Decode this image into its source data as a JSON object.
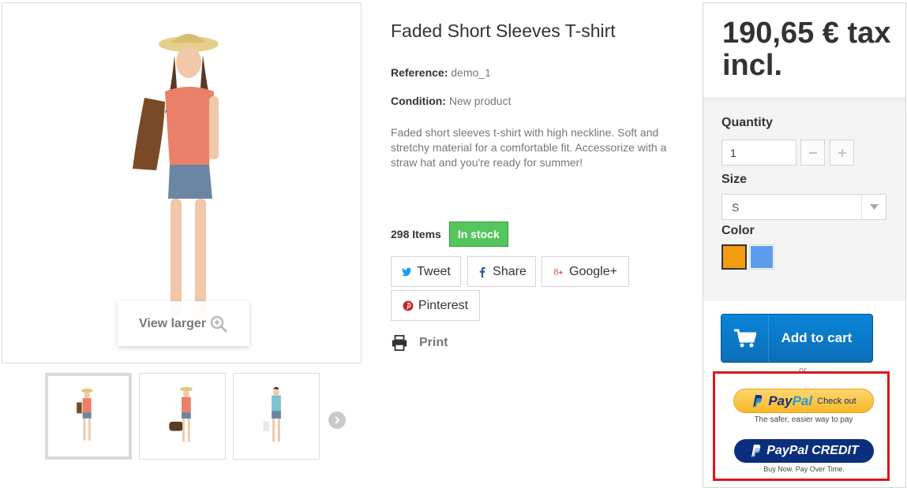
{
  "product": {
    "title": "Faded Short Sleeves T-shirt",
    "reference_label": "Reference:",
    "reference_value": "demo_1",
    "condition_label": "Condition:",
    "condition_value": "New product",
    "description": "Faded short sleeves t-shirt with high neckline. Soft and stretchy material for a comfortable fit. Accessorize with a straw hat and you're ready for summer!",
    "items_count": "298 Items",
    "stock_status": "In stock"
  },
  "gallery": {
    "view_larger_label": "View larger",
    "thumbnail_count": 3,
    "active_thumbnail": 1
  },
  "share": {
    "tweet": "Tweet",
    "share": "Share",
    "google_plus": "Google+",
    "pinterest": "Pinterest",
    "print": "Print"
  },
  "buybox": {
    "price": "190,65 € tax incl.",
    "quantity_label": "Quantity",
    "quantity_value": "1",
    "size_label": "Size",
    "size_value": "S",
    "color_label": "Color",
    "colors": [
      "#f39c11",
      "#5d9cec"
    ],
    "selected_color": "#f39c11",
    "add_to_cart": "Add to cart",
    "or_text": "or"
  },
  "paypal": {
    "pay": "Pay",
    "pal": "Pal",
    "checkout_label": "Check out",
    "checkout_tagline": "The safer, easier way to pay",
    "credit_label": "PayPal CREDIT",
    "credit_tagline": "Buy Now. Pay Over Time."
  },
  "colors": {
    "in_stock": "#55c65e",
    "cart_button": "#0b78c6",
    "paypal_gold": "#f7b927",
    "paypal_navy": "#0b2f7c",
    "highlight_border": "#e0141c"
  },
  "icons": {
    "zoom": "zoom-in-icon",
    "twitter": "twitter-icon",
    "facebook": "facebook-icon",
    "google_plus": "google-plus-icon",
    "pinterest": "pinterest-icon",
    "print": "printer-icon",
    "cart": "cart-icon",
    "next": "chevron-right-icon"
  }
}
